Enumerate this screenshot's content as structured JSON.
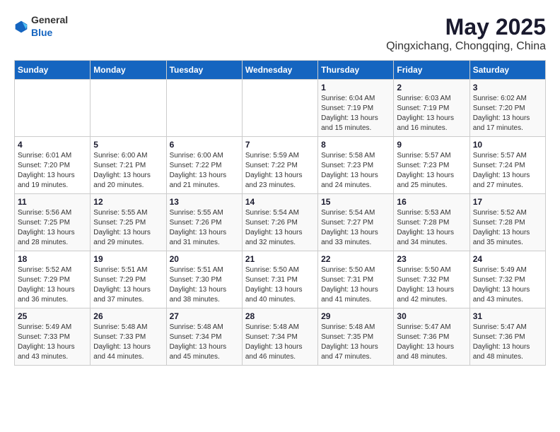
{
  "header": {
    "logo": {
      "general": "General",
      "blue": "Blue"
    },
    "title": "May 2025",
    "subtitle": "Qingxichang, Chongqing, China"
  },
  "weekdays": [
    "Sunday",
    "Monday",
    "Tuesday",
    "Wednesday",
    "Thursday",
    "Friday",
    "Saturday"
  ],
  "weeks": [
    [
      {
        "date": "",
        "info": ""
      },
      {
        "date": "",
        "info": ""
      },
      {
        "date": "",
        "info": ""
      },
      {
        "date": "",
        "info": ""
      },
      {
        "date": "1",
        "info": "Sunrise: 6:04 AM\nSunset: 7:19 PM\nDaylight: 13 hours and 15 minutes."
      },
      {
        "date": "2",
        "info": "Sunrise: 6:03 AM\nSunset: 7:19 PM\nDaylight: 13 hours and 16 minutes."
      },
      {
        "date": "3",
        "info": "Sunrise: 6:02 AM\nSunset: 7:20 PM\nDaylight: 13 hours and 17 minutes."
      }
    ],
    [
      {
        "date": "4",
        "info": "Sunrise: 6:01 AM\nSunset: 7:20 PM\nDaylight: 13 hours and 19 minutes."
      },
      {
        "date": "5",
        "info": "Sunrise: 6:00 AM\nSunset: 7:21 PM\nDaylight: 13 hours and 20 minutes."
      },
      {
        "date": "6",
        "info": "Sunrise: 6:00 AM\nSunset: 7:22 PM\nDaylight: 13 hours and 21 minutes."
      },
      {
        "date": "7",
        "info": "Sunrise: 5:59 AM\nSunset: 7:22 PM\nDaylight: 13 hours and 23 minutes."
      },
      {
        "date": "8",
        "info": "Sunrise: 5:58 AM\nSunset: 7:23 PM\nDaylight: 13 hours and 24 minutes."
      },
      {
        "date": "9",
        "info": "Sunrise: 5:57 AM\nSunset: 7:23 PM\nDaylight: 13 hours and 25 minutes."
      },
      {
        "date": "10",
        "info": "Sunrise: 5:57 AM\nSunset: 7:24 PM\nDaylight: 13 hours and 27 minutes."
      }
    ],
    [
      {
        "date": "11",
        "info": "Sunrise: 5:56 AM\nSunset: 7:25 PM\nDaylight: 13 hours and 28 minutes."
      },
      {
        "date": "12",
        "info": "Sunrise: 5:55 AM\nSunset: 7:25 PM\nDaylight: 13 hours and 29 minutes."
      },
      {
        "date": "13",
        "info": "Sunrise: 5:55 AM\nSunset: 7:26 PM\nDaylight: 13 hours and 31 minutes."
      },
      {
        "date": "14",
        "info": "Sunrise: 5:54 AM\nSunset: 7:26 PM\nDaylight: 13 hours and 32 minutes."
      },
      {
        "date": "15",
        "info": "Sunrise: 5:54 AM\nSunset: 7:27 PM\nDaylight: 13 hours and 33 minutes."
      },
      {
        "date": "16",
        "info": "Sunrise: 5:53 AM\nSunset: 7:28 PM\nDaylight: 13 hours and 34 minutes."
      },
      {
        "date": "17",
        "info": "Sunrise: 5:52 AM\nSunset: 7:28 PM\nDaylight: 13 hours and 35 minutes."
      }
    ],
    [
      {
        "date": "18",
        "info": "Sunrise: 5:52 AM\nSunset: 7:29 PM\nDaylight: 13 hours and 36 minutes."
      },
      {
        "date": "19",
        "info": "Sunrise: 5:51 AM\nSunset: 7:29 PM\nDaylight: 13 hours and 37 minutes."
      },
      {
        "date": "20",
        "info": "Sunrise: 5:51 AM\nSunset: 7:30 PM\nDaylight: 13 hours and 38 minutes."
      },
      {
        "date": "21",
        "info": "Sunrise: 5:50 AM\nSunset: 7:31 PM\nDaylight: 13 hours and 40 minutes."
      },
      {
        "date": "22",
        "info": "Sunrise: 5:50 AM\nSunset: 7:31 PM\nDaylight: 13 hours and 41 minutes."
      },
      {
        "date": "23",
        "info": "Sunrise: 5:50 AM\nSunset: 7:32 PM\nDaylight: 13 hours and 42 minutes."
      },
      {
        "date": "24",
        "info": "Sunrise: 5:49 AM\nSunset: 7:32 PM\nDaylight: 13 hours and 43 minutes."
      }
    ],
    [
      {
        "date": "25",
        "info": "Sunrise: 5:49 AM\nSunset: 7:33 PM\nDaylight: 13 hours and 43 minutes."
      },
      {
        "date": "26",
        "info": "Sunrise: 5:48 AM\nSunset: 7:33 PM\nDaylight: 13 hours and 44 minutes."
      },
      {
        "date": "27",
        "info": "Sunrise: 5:48 AM\nSunset: 7:34 PM\nDaylight: 13 hours and 45 minutes."
      },
      {
        "date": "28",
        "info": "Sunrise: 5:48 AM\nSunset: 7:34 PM\nDaylight: 13 hours and 46 minutes."
      },
      {
        "date": "29",
        "info": "Sunrise: 5:48 AM\nSunset: 7:35 PM\nDaylight: 13 hours and 47 minutes."
      },
      {
        "date": "30",
        "info": "Sunrise: 5:47 AM\nSunset: 7:36 PM\nDaylight: 13 hours and 48 minutes."
      },
      {
        "date": "31",
        "info": "Sunrise: 5:47 AM\nSunset: 7:36 PM\nDaylight: 13 hours and 48 minutes."
      }
    ]
  ]
}
